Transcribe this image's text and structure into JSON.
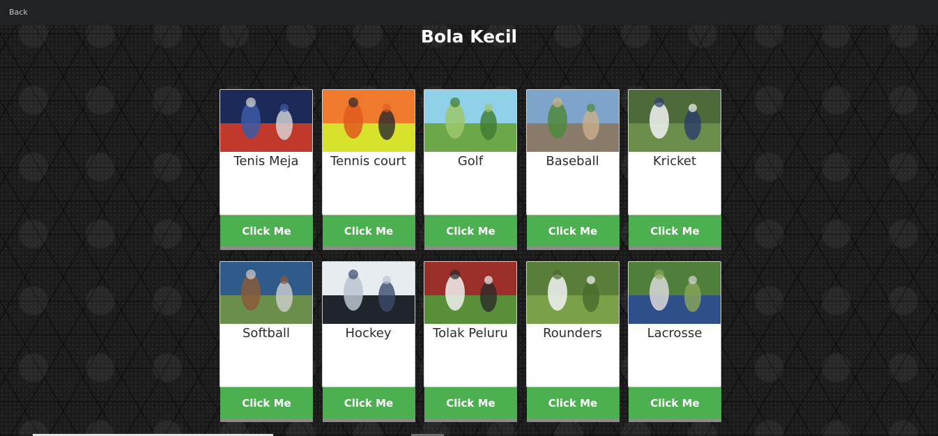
{
  "topbar": {
    "back_label": "Back"
  },
  "page": {
    "title": "Bola Kecil"
  },
  "cards": [
    {
      "label": "Tenis Meja",
      "button": "Click Me",
      "image": "table-tennis-photo",
      "colors": [
        "#1c2a5a",
        "#c0392b",
        "#3b5ba5",
        "#d9d9d9"
      ]
    },
    {
      "label": "Tennis court",
      "button": "Click Me",
      "image": "tennis-racket-balls-photo",
      "colors": [
        "#f07a2c",
        "#d6e32a",
        "#e05a1f",
        "#2a2a2a"
      ]
    },
    {
      "label": "Golf",
      "button": "Click Me",
      "image": "golf-course-photo",
      "colors": [
        "#8fd1e8",
        "#6ca84a",
        "#9cc86a",
        "#3d7a2d"
      ]
    },
    {
      "label": "Baseball",
      "button": "Click Me",
      "image": "baseball-stadium-photo",
      "colors": [
        "#7fa4c9",
        "#8a7a6a",
        "#4e8a3d",
        "#c9b08a"
      ]
    },
    {
      "label": "Kricket",
      "button": "Click Me",
      "image": "cricket-players-photo",
      "colors": [
        "#4d6b3a",
        "#6b8f4a",
        "#f2f2f2",
        "#2a3c6b"
      ]
    },
    {
      "label": "Softball",
      "button": "Click Me",
      "image": "softball-collage-photo",
      "colors": [
        "#2e5a8a",
        "#6a8f4a",
        "#8a5a3a",
        "#cfcfcf"
      ]
    },
    {
      "label": "Hockey",
      "button": "Click Me",
      "image": "ice-hockey-photo",
      "colors": [
        "#e8edf2",
        "#20252c",
        "#b8c4d0",
        "#3a4a6a"
      ]
    },
    {
      "label": "Tolak Peluru",
      "button": "Click Me",
      "image": "shot-put-photo",
      "colors": [
        "#9a2f2a",
        "#5a8f3a",
        "#f0f0f0",
        "#2a2a2a"
      ]
    },
    {
      "label": "Rounders",
      "button": "Click Me",
      "image": "rounders-field-photo",
      "colors": [
        "#5a7f3a",
        "#7aa04a",
        "#f2f2f2",
        "#4a6a2a"
      ]
    },
    {
      "label": "Lacrosse",
      "button": "Click Me",
      "image": "lacrosse-match-photo",
      "colors": [
        "#4f7f3a",
        "#2e4f8a",
        "#d8d8d8",
        "#8aa85a"
      ]
    }
  ]
}
